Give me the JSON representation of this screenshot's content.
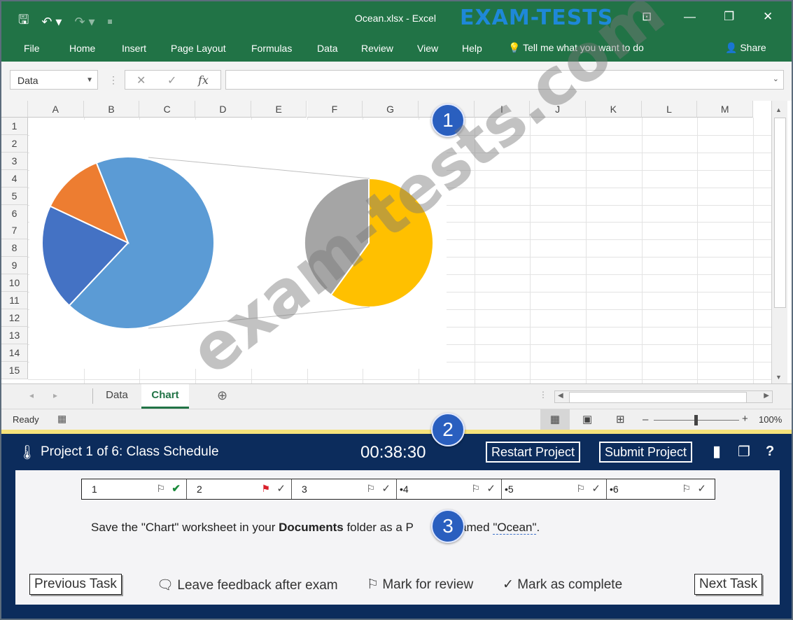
{
  "window": {
    "doc_title": "Ocean.xlsx - Excel",
    "brand_logo": "EXAM-TESTS"
  },
  "ribbon": {
    "tabs": [
      "File",
      "Home",
      "Insert",
      "Page Layout",
      "Formulas",
      "Data",
      "Review",
      "View",
      "Help"
    ],
    "tell_me": "Tell me what you want to do",
    "share": "Share"
  },
  "formula_bar": {
    "name_box": "Data",
    "fx": "fx",
    "formula": ""
  },
  "grid": {
    "columns": [
      "A",
      "B",
      "C",
      "D",
      "E",
      "F",
      "G",
      "H",
      "I",
      "J",
      "K",
      "L",
      "M"
    ],
    "rows": [
      "1",
      "2",
      "3",
      "4",
      "5",
      "6",
      "7",
      "8",
      "9",
      "10",
      "11",
      "12",
      "13",
      "14",
      "15"
    ]
  },
  "chart_data": {
    "type": "pie",
    "primary": {
      "slices": [
        {
          "value": 68,
          "color": "#5b9bd5"
        },
        {
          "value": 20,
          "color": "#4472c4"
        },
        {
          "value": 12,
          "color": "#ed7d31"
        }
      ]
    },
    "secondary": {
      "slices": [
        {
          "value": 60,
          "color": "#ffc000"
        },
        {
          "value": 40,
          "color": "#a5a5a5"
        }
      ]
    }
  },
  "sheets": {
    "tabs": [
      "Data",
      "Chart"
    ],
    "active": "Chart"
  },
  "status": {
    "ready": "Ready",
    "zoom": "100%"
  },
  "exam": {
    "project_title": "Project 1 of 6: Class Schedule",
    "timer": "00:38:30",
    "restart_label": "Restart Project",
    "submit_label": "Submit Project",
    "help_label": "?",
    "tasks": [
      {
        "label": "1"
      },
      {
        "label": "2"
      },
      {
        "label": "3"
      },
      {
        "label": "•4"
      },
      {
        "label": "•5"
      },
      {
        "label": "•6"
      }
    ],
    "instruction": {
      "part1": "Save the \"Chart\" worksheet in your ",
      "bold": "Documents",
      "part2": " folder as a P",
      "part3": " named ",
      "filename": "\"Ocean\"",
      "end": "."
    },
    "previous_label": "Previous Task",
    "feedback_label": "Leave feedback after exam",
    "review_label": "Mark for review",
    "complete_label": "Mark as complete",
    "next_label": "Next Task"
  },
  "badges": [
    "1",
    "2",
    "3"
  ],
  "watermark": "exam-tests.com",
  "colors": {
    "excel_green": "#217346",
    "exam_navy": "#0c2c5c",
    "badge_blue": "#2a5fbf",
    "flag_red": "#d9202b",
    "check_green": "#1a8a3a"
  }
}
